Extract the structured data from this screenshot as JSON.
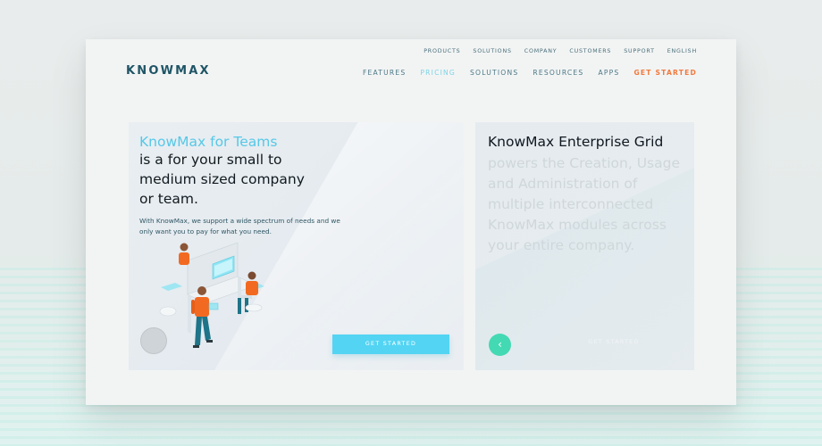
{
  "brand": {
    "logo": "KNOWMAX"
  },
  "top_nav": [
    "PRODUCTS",
    "SOLUTIONS",
    "COMPANY",
    "CUSTOMERS",
    "SUPPORT",
    "ENGLISH"
  ],
  "main_nav": {
    "features": "FEATURES",
    "pricing": "PRICING",
    "solutions": "SOLUTIONS",
    "resources": "RESOURCES",
    "apps": "APPS",
    "get_started": "GET STARTED"
  },
  "teams_card": {
    "accent_title": "KnowMax for Teams",
    "heading": "is a for your small to medium sized company or team.",
    "body": "With KnowMax, we support a wide spectrum of needs and we only want you to pay for what you need.",
    "cta": "GET STARTED"
  },
  "enterprise_card": {
    "title": "KnowMax Enterprise Grid",
    "description": "powers the Creation, Usage and Administration of multiple interconnected KnowMax modules across your entire company.",
    "back_icon": "chevron-left-icon",
    "cta": "GET STARTED"
  },
  "colors": {
    "brand": "#1f5566",
    "accent_blue": "#56c8e7",
    "cta_orange": "#f07a3e",
    "button_cyan": "#53d4f3",
    "back_green": "#43d9b3"
  }
}
